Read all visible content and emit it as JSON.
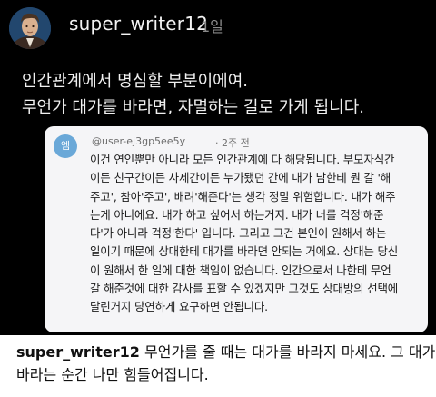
{
  "post": {
    "username": "super_writer12",
    "time": "1일",
    "lines": [
      "인간관계에서 명심할 부분이에여.",
      "무언가 대가를 바라면, 자멸하는 길로 가게 됩니다."
    ]
  },
  "quoted_comment": {
    "avatar_text": "엠",
    "user": "@user-ej3gp5ee5y",
    "time": "· 2주 전",
    "lines": [
      "이건 연인뿐만 아니라 모든 인간관계에 다 해당됩니다. 부모자식간",
      "이든 친구간이든 사제간이든 누가됐던 간에 내가 남한테 뭔 갈 '해",
      "주고', 참아'주고', 배려'해준다'는 생각 정말 위험합니다. 내가 해주",
      "는게 아니에요. 내가 하고 싶어서 하는거지. 내가 너를 걱정'해준",
      "다'가 아니라 걱정'한다' 입니다. 그리고 그건 본인이 원해서 하는",
      "일이기 때문에 상대한테 대가를 바라면 안되는 거에요. 상대는 당신",
      "이 원해서 한 일에 대한 책임이 없습니다. 인간으로서 나한테 무언",
      "갈 해준것에 대한 감사를 표할 수 있겠지만 그것도 상대방의 선택에",
      "달린거지 당연하게 요구하면 안됩니다."
    ]
  },
  "caption": {
    "username": "super_writer12",
    "line1": " 무언가를 줄 때는 대가를 바라지 마세요. 그 대가를",
    "line2": "바라는 순간 나만 힘들어집니다."
  },
  "colors": {
    "background": "#000000",
    "card": "#f5f5f7",
    "caption_bg": "#ffffff",
    "avatar_circle": "#6aa8d8"
  }
}
